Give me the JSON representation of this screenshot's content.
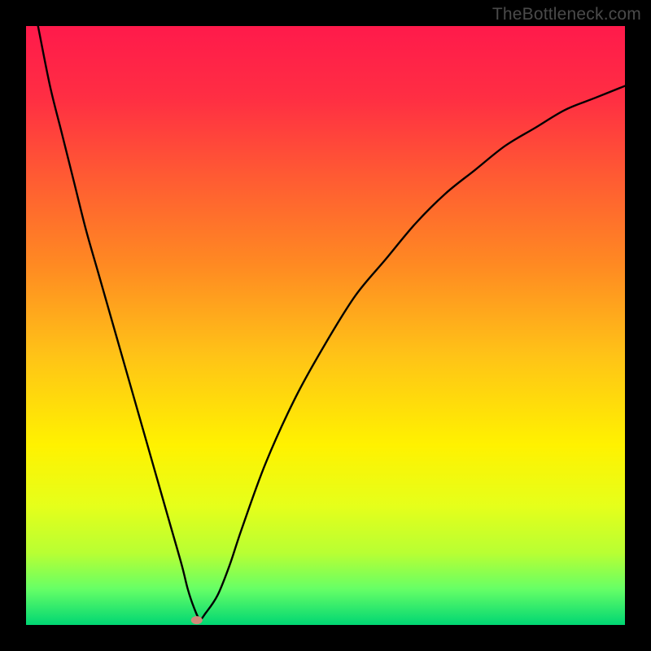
{
  "watermark": "TheBottleneck.com",
  "chart_data": {
    "type": "line",
    "title": "",
    "xlabel": "",
    "ylabel": "",
    "xlim": [
      0,
      100
    ],
    "ylim": [
      0,
      100
    ],
    "grid": false,
    "legend": false,
    "background_gradient_stops": [
      {
        "pos": 0.0,
        "color": "#ff1a4b"
      },
      {
        "pos": 0.12,
        "color": "#ff2e43"
      },
      {
        "pos": 0.25,
        "color": "#ff5a33"
      },
      {
        "pos": 0.4,
        "color": "#ff8a22"
      },
      {
        "pos": 0.55,
        "color": "#ffc317"
      },
      {
        "pos": 0.7,
        "color": "#fff200"
      },
      {
        "pos": 0.8,
        "color": "#e6ff1a"
      },
      {
        "pos": 0.88,
        "color": "#b8ff33"
      },
      {
        "pos": 0.94,
        "color": "#66ff66"
      },
      {
        "pos": 1.0,
        "color": "#00d673"
      }
    ],
    "series": [
      {
        "name": "curve",
        "x": [
          0,
          2,
          4,
          6,
          8,
          10,
          12,
          14,
          16,
          18,
          20,
          22,
          24,
          26,
          27,
          28,
          29,
          30,
          32,
          34,
          36,
          40,
          45,
          50,
          55,
          60,
          65,
          70,
          75,
          80,
          85,
          90,
          95,
          100
        ],
        "y": [
          110,
          100,
          90,
          82,
          74,
          66,
          59,
          52,
          45,
          38,
          31,
          24,
          17,
          10,
          6,
          3,
          1,
          2,
          5,
          10,
          16,
          27,
          38,
          47,
          55,
          61,
          67,
          72,
          76,
          80,
          83,
          86,
          88,
          90
        ]
      }
    ],
    "marker": {
      "x": 28.5,
      "y": 0.8,
      "color": "#d08a7a",
      "rx": 7,
      "ry": 5
    }
  }
}
